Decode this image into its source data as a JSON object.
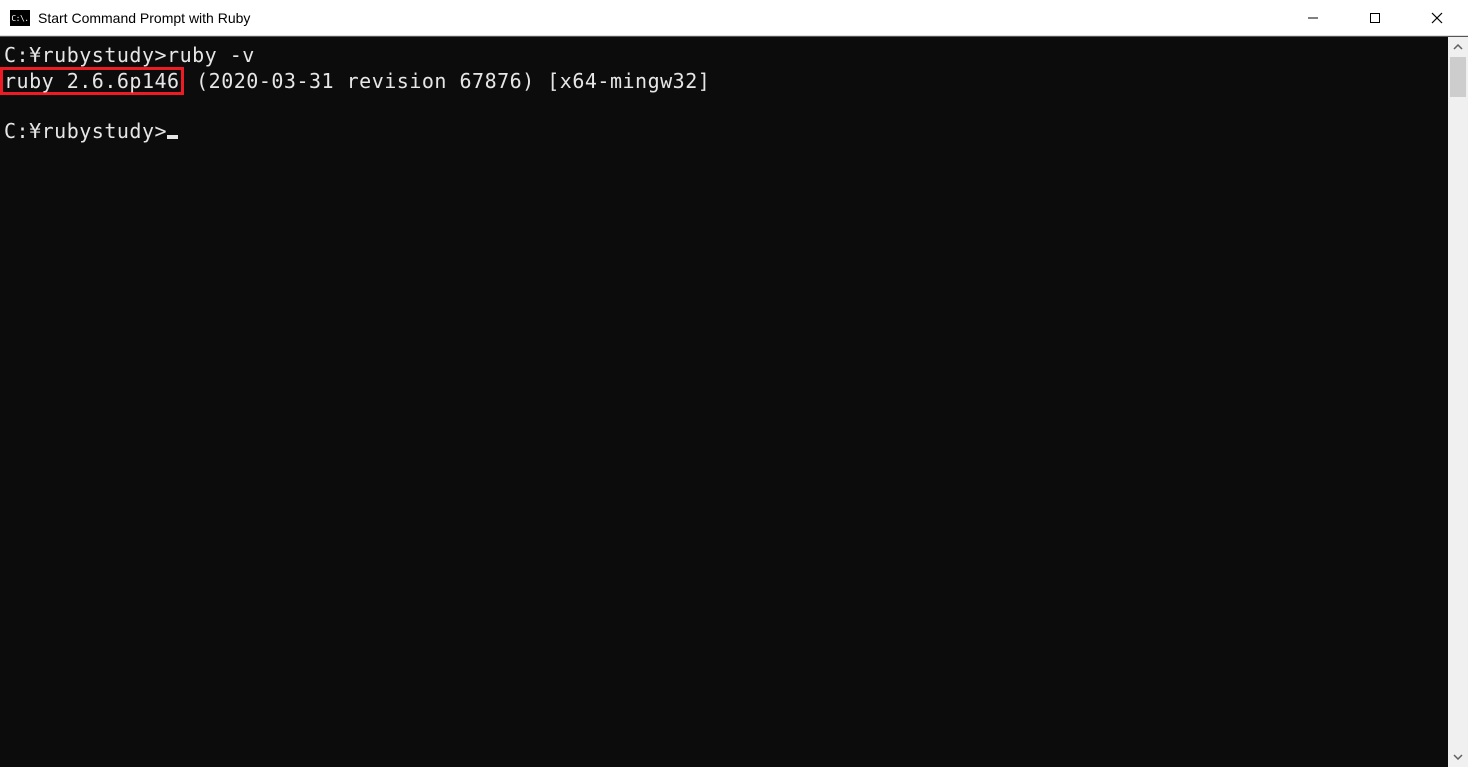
{
  "window": {
    "icon_label": "C:\\.",
    "title": "Start Command Prompt with Ruby"
  },
  "terminal": {
    "line1_prompt": "C:¥rubystudy>",
    "line1_cmd": "ruby -v",
    "line2_highlight": "ruby 2.6.6p146",
    "line2_rest": " (2020-03-31 revision 67876) [x64-mingw32]",
    "line3_prompt": "C:¥rubystudy>"
  }
}
